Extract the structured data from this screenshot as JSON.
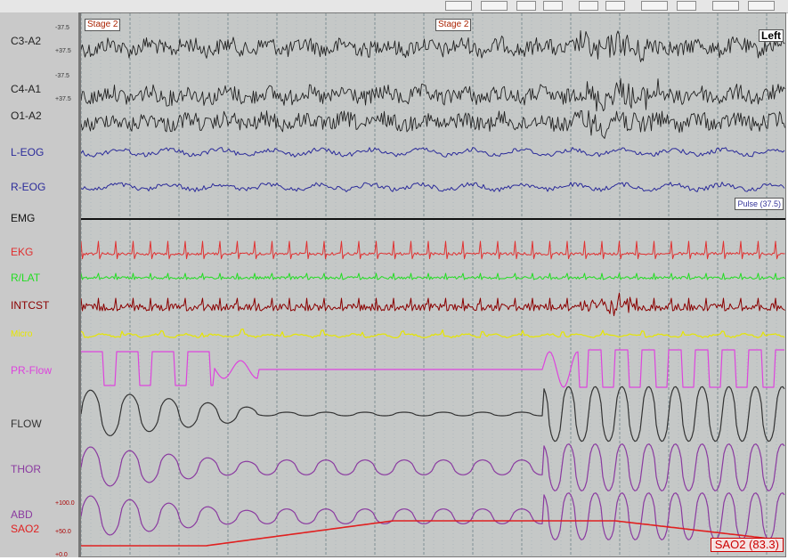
{
  "window": {
    "title": ""
  },
  "channels": [
    {
      "id": "c3a2",
      "label": "C3-A2",
      "color": "#222222",
      "scale_top": "-37.5",
      "scale_bot": "+37.5",
      "kind": "eeg"
    },
    {
      "id": "c4a1",
      "label": "C4-A1",
      "color": "#222222",
      "scale_top": "-37.5",
      "scale_bot": "+37.5",
      "kind": "eeg"
    },
    {
      "id": "o1a2",
      "label": "O1-A2",
      "color": "#222222",
      "scale_top": "",
      "scale_bot": "",
      "kind": "eeg"
    },
    {
      "id": "leog",
      "label": "L-EOG",
      "color": "#2b2b9a",
      "kind": "eog"
    },
    {
      "id": "reog",
      "label": "R-EOG",
      "color": "#2b2b9a",
      "kind": "eog"
    },
    {
      "id": "emg",
      "label": "EMG",
      "color": "#111111",
      "kind": "emg"
    },
    {
      "id": "ekg",
      "label": "EKG",
      "color": "#e03030",
      "kind": "ekg"
    },
    {
      "id": "rlat",
      "label": "R/LAT",
      "color": "#22dd22",
      "kind": "lat"
    },
    {
      "id": "intcst",
      "label": "INTCST",
      "color": "#8a0000",
      "kind": "intcst"
    },
    {
      "id": "micro",
      "label": "Micro",
      "color": "#e6e600",
      "kind": "micro"
    },
    {
      "id": "prflow",
      "label": "PR-Flow",
      "color": "#dd44dd",
      "kind": "prflow"
    },
    {
      "id": "flow",
      "label": "FLOW",
      "color": "#333333",
      "kind": "flow"
    },
    {
      "id": "thor",
      "label": "THOR",
      "color": "#8a3aa0",
      "kind": "thor"
    },
    {
      "id": "abd",
      "label": "ABD",
      "color": "#8a3aa0",
      "kind": "abd"
    },
    {
      "id": "sao2",
      "label": "SAO2",
      "color": "#e02020",
      "kind": "sao2"
    }
  ],
  "abd_scale": {
    "top": "+100.0",
    "mid": "+50.0",
    "bot": "+0.0"
  },
  "annotations": {
    "stage_a": "Stage 2",
    "stage_b": "Stage 2",
    "left": "Left",
    "pulse": "Pulse (37.5)",
    "sao2_readout": "SAO2 (83.3)"
  },
  "colors": {
    "plot_bg": "#c5c8c7",
    "label_bg": "#c9c9c9",
    "grid_major": "#7f9096",
    "grid_minor": "#9fb0b6"
  }
}
